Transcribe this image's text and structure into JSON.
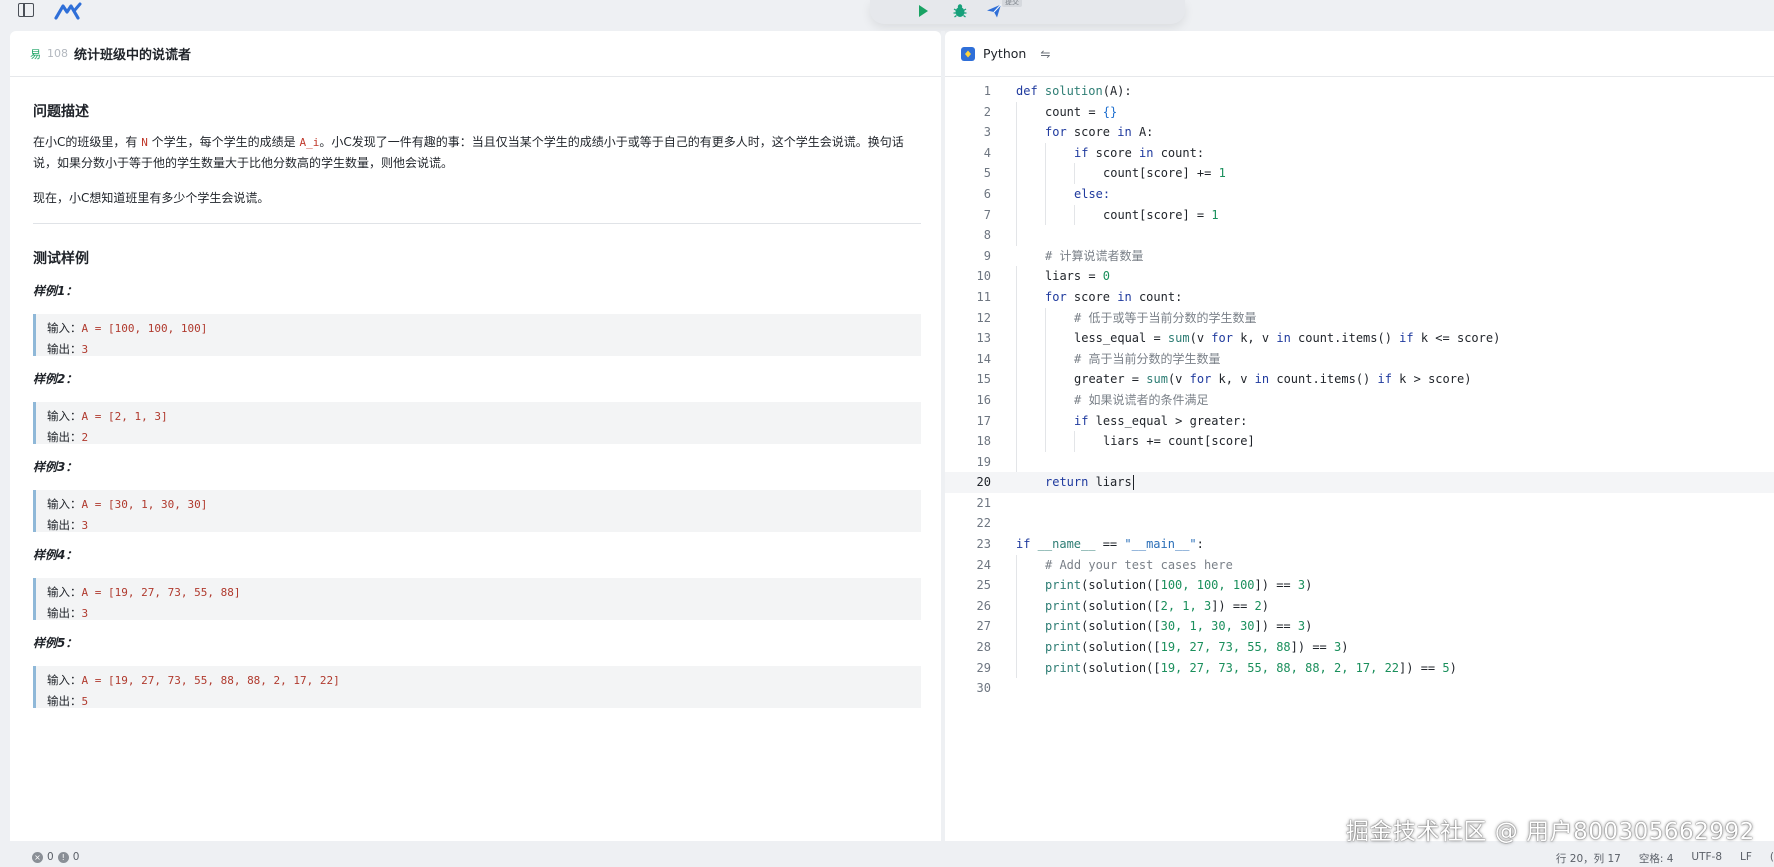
{
  "toolbar": {
    "submit_badge": "提交"
  },
  "problem": {
    "difficulty": "易",
    "id": "108",
    "title": "统计班级中的说谎者",
    "section_description": "问题描述",
    "desc_p1_a": "在小C的班级里，有 ",
    "desc_p1_var_n": "N",
    "desc_p1_b": " 个学生，每个学生的成绩是 ",
    "desc_p1_var_a": "A_i",
    "desc_p1_c": "。小C发现了一件有趣的事：当且仅当某个学生的成绩小于或等于自己的有更多人时，这个学生会说谎。换句话说，如果分数小于等于他的学生数量大于比他分数高的学生数量，则他会说谎。",
    "desc_p2": "现在，小C想知道班里有多少个学生会说谎。",
    "section_examples": "测试样例",
    "input_label": "输入：",
    "output_label": "输出：",
    "examples": [
      {
        "title": "样例1：",
        "input": "A = [100, 100, 100]",
        "output": "3"
      },
      {
        "title": "样例2：",
        "input": "A = [2, 1, 3]",
        "output": "2"
      },
      {
        "title": "样例3：",
        "input": "A = [30, 1, 30, 30]",
        "output": "3"
      },
      {
        "title": "样例4：",
        "input": "A = [19, 27, 73, 55, 88]",
        "output": "3"
      },
      {
        "title": "样例5：",
        "input": "A = [19, 27, 73, 55, 88, 88, 2, 17, 22]",
        "output": "5"
      }
    ]
  },
  "editor": {
    "language": "Python",
    "line_numbers": [
      "1",
      "2",
      "3",
      "4",
      "5",
      "6",
      "7",
      "8",
      "9",
      "10",
      "11",
      "12",
      "13",
      "14",
      "15",
      "16",
      "17",
      "18",
      "19",
      "20",
      "21",
      "22",
      "23",
      "24",
      "25",
      "26",
      "27",
      "28",
      "29",
      "30"
    ],
    "active_line": 20,
    "code": {
      "l1_def": "def",
      "l1_name": " solution",
      "l1_rest": "(A):",
      "l2": "count = ",
      "l2_braces": "{}",
      "l3_for": "for",
      "l3_a": " score ",
      "l3_in": "in",
      "l3_b": " A:",
      "l4_if": "if",
      "l4_a": " score ",
      "l4_in": "in",
      "l4_b": " count:",
      "l5_a": "count[score] += ",
      "l5_num": "1",
      "l6": "else:",
      "l7_a": "count[score] = ",
      "l7_num": "1",
      "l9": "# 计算说谎者数量",
      "l10_a": "liars = ",
      "l10_num": "0",
      "l11_for": "for",
      "l11_a": " score ",
      "l11_in": "in",
      "l11_b": " count:",
      "l12": "# 低于或等于当前分数的学生数量",
      "l13_a": "less_equal = ",
      "l13_sum": "sum",
      "l13_b": "(v ",
      "l13_for": "for",
      "l13_c": " k, v ",
      "l13_in": "in",
      "l13_d": " count.items() ",
      "l13_if": "if",
      "l13_e": " k <= score)",
      "l14": "# 高于当前分数的学生数量",
      "l15_a": "greater = ",
      "l15_sum": "sum",
      "l15_b": "(v ",
      "l15_for": "for",
      "l15_c": " k, v ",
      "l15_in": "in",
      "l15_d": " count.items() ",
      "l15_if": "if",
      "l15_e": " k > score)",
      "l16": "# 如果说谎者的条件满足",
      "l17_if": "if",
      "l17_b": " less_equal > greater:",
      "l18": "liars += count[score]",
      "l20_ret": "return",
      "l20_b": " liars",
      "l23_if": "if",
      "l23_b": " __name__ ",
      "l23_c": "== ",
      "l23_str": "\"__main__\"",
      "l23_d": ":",
      "l24": "# Add your test cases here",
      "l25_print": "print",
      "l25_a": "(solution([",
      "l25_nums": "100, 100, 100",
      "l25_b": "]) == ",
      "l25_num": "3",
      "l25_c": ")",
      "l26_print": "print",
      "l26_a": "(solution([",
      "l26_nums": "2, 1, 3",
      "l26_b": "]) == ",
      "l26_num": "2",
      "l26_c": ")",
      "l27_print": "print",
      "l27_a": "(solution([",
      "l27_nums": "30, 1, 30, 30",
      "l27_b": "]) == ",
      "l27_num": "3",
      "l27_c": ")",
      "l28_print": "print",
      "l28_a": "(solution([",
      "l28_nums": "19, 27, 73, 55, 88",
      "l28_b": "]) == ",
      "l28_num": "3",
      "l28_c": ")",
      "l29_print": "print",
      "l29_a": "(solution([",
      "l29_nums": "19, 27, 73, 55, 88, 88, 2, 17, 22",
      "l29_b": "]) == ",
      "l29_num": "5",
      "l29_c": ")"
    }
  },
  "watermark": "掘金技术社区 @ 用户800305662992",
  "status": {
    "errors": "0",
    "warnings": "0",
    "position": "行 20，列 17",
    "spaces": "空格: 4",
    "encoding": "UTF-8",
    "eol": "LF",
    "trailing": "("
  },
  "colors": {
    "accent": "#1f6fcf",
    "difficulty_easy": "#1aa364",
    "run": "#1aa364",
    "debug": "#16a07a",
    "submit": "#2f6fd8"
  }
}
